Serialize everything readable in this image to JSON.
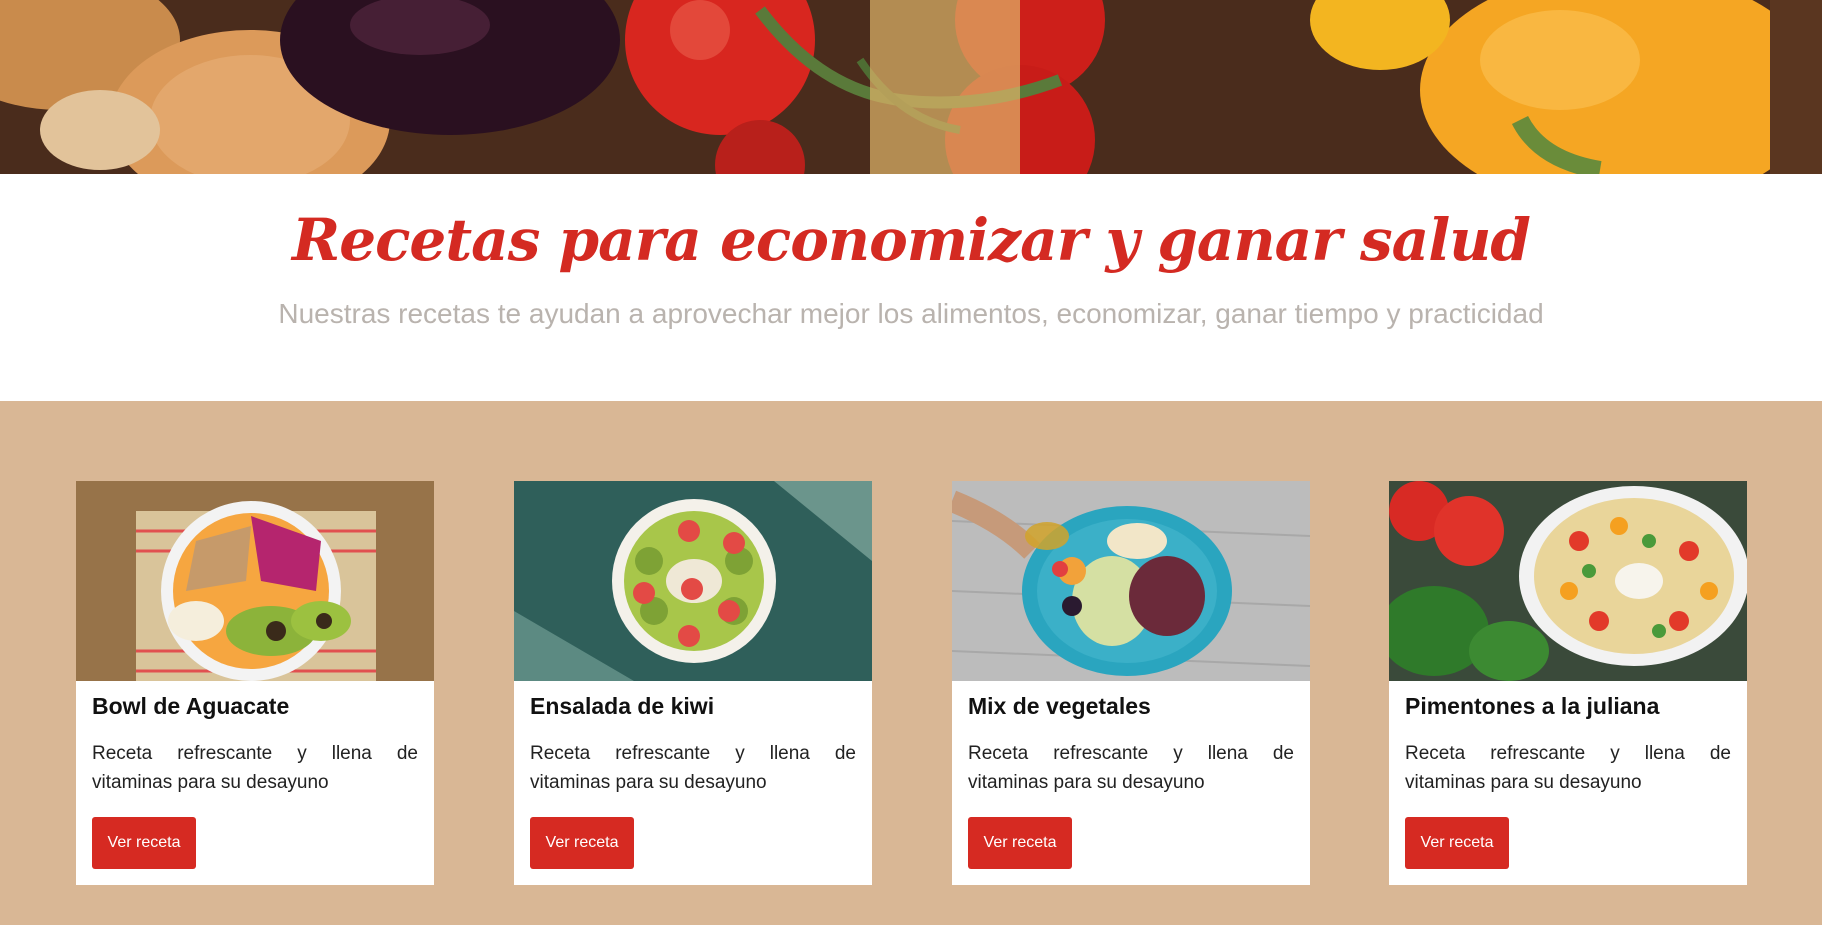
{
  "hero": {
    "image": "vegetables-banner"
  },
  "intro": {
    "title": "Recetas para economizar y ganar salud",
    "subtitle": "Nuestras recetas te ayudan a aprovechar mejor los alimentos, economizar, ganar tiempo y practicidad"
  },
  "cards": [
    {
      "title": "Bowl de Aguacate",
      "description": "Receta refrescante y llena de vitaminas para su desayuno",
      "button": "Ver receta",
      "image": "avocado-bowl"
    },
    {
      "title": "Ensalada de kiwi",
      "description": "Receta refrescante y llena de vitaminas para su desayuno",
      "button": "Ver receta",
      "image": "kiwi-bowl"
    },
    {
      "title": "Mix de vegetales",
      "description": "Receta refrescante y llena de vitaminas para su desayuno",
      "button": "Ver receta",
      "image": "vegetable-plate"
    },
    {
      "title": "Pimentones a la juliana",
      "description": "Receta refrescante y llena de vitaminas para su desayuno",
      "button": "Ver receta",
      "image": "pepper-salad"
    }
  ],
  "colors": {
    "accent": "#d62a22",
    "section_bg": "#d9b795",
    "subtitle": "#b9b3ae"
  }
}
